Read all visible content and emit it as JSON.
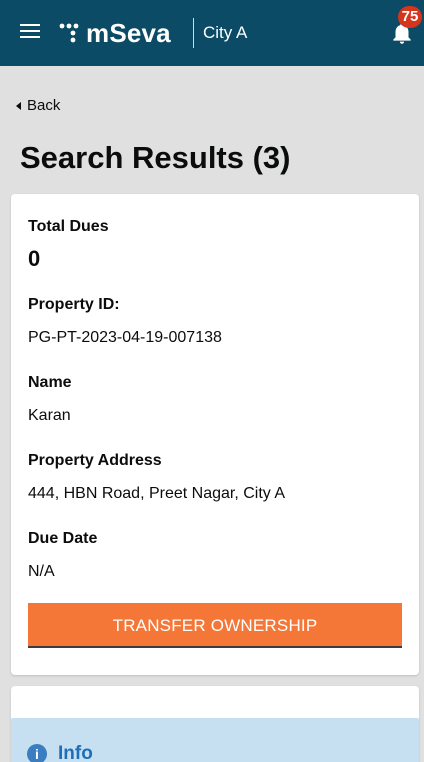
{
  "header": {
    "brand": "mSeva",
    "city": "City A",
    "notification_count": "75",
    "colors": {
      "bar": "#0b4b66",
      "badge": "#d4351c"
    }
  },
  "nav": {
    "back_label": "Back"
  },
  "page": {
    "title": "Search Results (3)"
  },
  "result": {
    "total_dues_label": "Total Dues",
    "total_dues_value": "0",
    "property_id_label": "Property ID:",
    "property_id_value": "PG-PT-2023-04-19-007138",
    "name_label": "Name",
    "name_value": "Karan",
    "address_label": "Property Address",
    "address_value": "444, HBN Road, Preet Nagar, City A",
    "due_date_label": "Due Date",
    "due_date_value": "N/A",
    "action_label": "TRANSFER OWNERSHIP",
    "action_color": "#f47738"
  },
  "info": {
    "label": "Info",
    "icon": "info-icon"
  }
}
